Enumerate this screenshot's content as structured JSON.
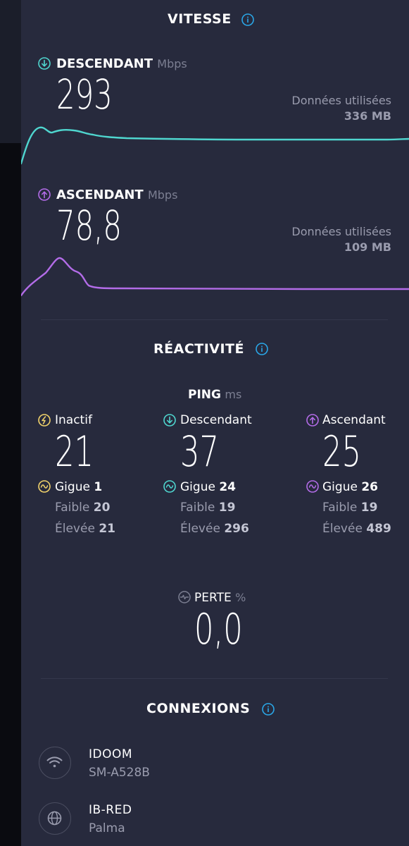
{
  "colors": {
    "download": "#4fd6cf",
    "upload": "#b36ce8",
    "idle": "#f2d36b",
    "info": "#2aa7e8",
    "panel": "#272a3d"
  },
  "speed": {
    "title": "VITESSE",
    "download": {
      "label": "DESCENDANT",
      "unit": "Mbps",
      "value": "293",
      "data_used_label": "Données utilisées",
      "data_used_value": "336 MB"
    },
    "upload": {
      "label": "ASCENDANT",
      "unit": "Mbps",
      "value": "78,8",
      "data_used_label": "Données utilisées",
      "data_used_value": "109 MB"
    }
  },
  "responsiveness": {
    "title": "RÉACTIVITÉ",
    "ping_label": "PING",
    "ping_unit": "ms",
    "columns": [
      {
        "label": "Inactif",
        "value": "21",
        "jitter_label": "Gigue",
        "jitter": "1",
        "low_label": "Faible",
        "low": "20",
        "high_label": "Élevée",
        "high": "21",
        "icon": "idle-icon"
      },
      {
        "label": "Descendant",
        "value": "37",
        "jitter_label": "Gigue",
        "jitter": "24",
        "low_label": "Faible",
        "low": "19",
        "high_label": "Élevée",
        "high": "296",
        "icon": "download-arrow-icon"
      },
      {
        "label": "Ascendant",
        "value": "25",
        "jitter_label": "Gigue",
        "jitter": "26",
        "low_label": "Faible",
        "low": "19",
        "high_label": "Élevée",
        "high": "489",
        "icon": "upload-arrow-icon"
      }
    ],
    "loss_label": "PERTE",
    "loss_unit": "%",
    "loss_value": "0,0"
  },
  "connections": {
    "title": "CONNEXIONS",
    "items": [
      {
        "name": "IDOOM",
        "detail": "SM-A528B",
        "icon": "wifi-icon"
      },
      {
        "name": "IB-RED",
        "detail": "Palma",
        "icon": "globe-icon"
      }
    ]
  }
}
